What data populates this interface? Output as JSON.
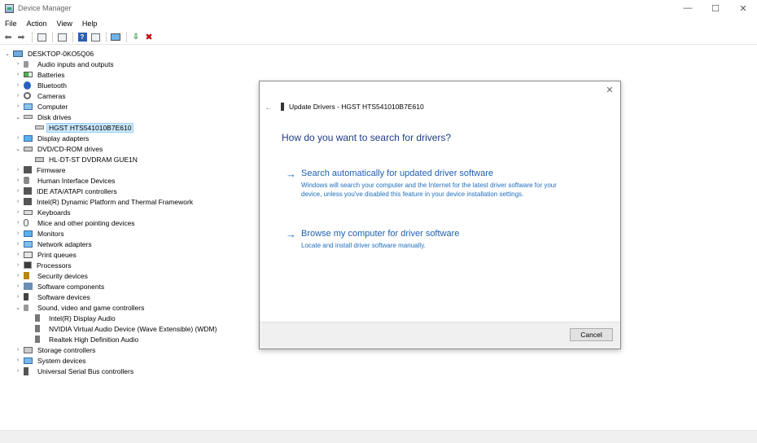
{
  "window": {
    "title": "Device Manager"
  },
  "window_controls": {
    "minimize": "—",
    "maximize": "☐",
    "close": "✕"
  },
  "menu": [
    "File",
    "Action",
    "View",
    "Help"
  ],
  "tree": {
    "root": "DESKTOP-0KO5Q06",
    "items": [
      {
        "label": "Audio inputs and outputs",
        "icon": "speaker-icon",
        "expanded": false
      },
      {
        "label": "Batteries",
        "icon": "battery-icon",
        "expanded": false
      },
      {
        "label": "Bluetooth",
        "icon": "bluetooth-icon",
        "expanded": false
      },
      {
        "label": "Cameras",
        "icon": "camera-icon",
        "expanded": false
      },
      {
        "label": "Computer",
        "icon": "computer-icon",
        "expanded": false
      },
      {
        "label": "Disk drives",
        "icon": "disk-icon",
        "expanded": true
      },
      {
        "label": "HGST HTS541010B7E610",
        "icon": "disk-icon",
        "child": true,
        "selected": true
      },
      {
        "label": "Display adapters",
        "icon": "monitor-icon",
        "expanded": false
      },
      {
        "label": "DVD/CD-ROM drives",
        "icon": "dvd-icon",
        "expanded": true
      },
      {
        "label": "HL-DT-ST DVDRAM GUE1N",
        "icon": "dvd-icon",
        "child": true
      },
      {
        "label": "Firmware",
        "icon": "chip-icon",
        "expanded": false
      },
      {
        "label": "Human Interface Devices",
        "icon": "hid-icon",
        "expanded": false
      },
      {
        "label": "IDE ATA/ATAPI controllers",
        "icon": "chip-icon",
        "expanded": false
      },
      {
        "label": "Intel(R) Dynamic Platform and Thermal Framework",
        "icon": "chip-icon",
        "expanded": false
      },
      {
        "label": "Keyboards",
        "icon": "keyboard-icon",
        "expanded": false
      },
      {
        "label": "Mice and other pointing devices",
        "icon": "mouse-icon",
        "expanded": false
      },
      {
        "label": "Monitors",
        "icon": "monitor-icon",
        "expanded": false
      },
      {
        "label": "Network adapters",
        "icon": "network-icon",
        "expanded": false
      },
      {
        "label": "Print queues",
        "icon": "printer-icon",
        "expanded": false
      },
      {
        "label": "Processors",
        "icon": "processor-icon",
        "expanded": false
      },
      {
        "label": "Security devices",
        "icon": "key-icon",
        "expanded": false
      },
      {
        "label": "Software components",
        "icon": "component-icon",
        "expanded": false
      },
      {
        "label": "Software devices",
        "icon": "software-icon",
        "expanded": false
      },
      {
        "label": "Sound, video and game controllers",
        "icon": "speaker-icon",
        "expanded": true
      },
      {
        "label": "Intel(R) Display Audio",
        "icon": "audio-device-icon",
        "child": true
      },
      {
        "label": "NVIDIA Virtual Audio Device (Wave Extensible) (WDM)",
        "icon": "audio-device-icon",
        "child": true
      },
      {
        "label": "Realtek High Definition Audio",
        "icon": "audio-device-icon",
        "child": true
      },
      {
        "label": "Storage controllers",
        "icon": "storage-icon",
        "expanded": false
      },
      {
        "label": "System devices",
        "icon": "system-icon",
        "expanded": false
      },
      {
        "label": "Universal Serial Bus controllers",
        "icon": "usb-icon",
        "expanded": false
      }
    ]
  },
  "dialog": {
    "title": "Update Drivers - HGST HTS541010B7E610",
    "heading": "How do you want to search for drivers?",
    "options": [
      {
        "title": "Search automatically for updated driver software",
        "description": "Windows will search your computer and the Internet for the latest driver software for your device, unless you've disabled this feature in your device installation settings."
      },
      {
        "title": "Browse my computer for driver software",
        "description": "Locate and install driver software manually."
      }
    ],
    "cancel_label": "Cancel"
  },
  "colors": {
    "link_blue": "#1e5fb4",
    "heading_blue": "#1f3c88",
    "selection": "#cce8ff"
  }
}
